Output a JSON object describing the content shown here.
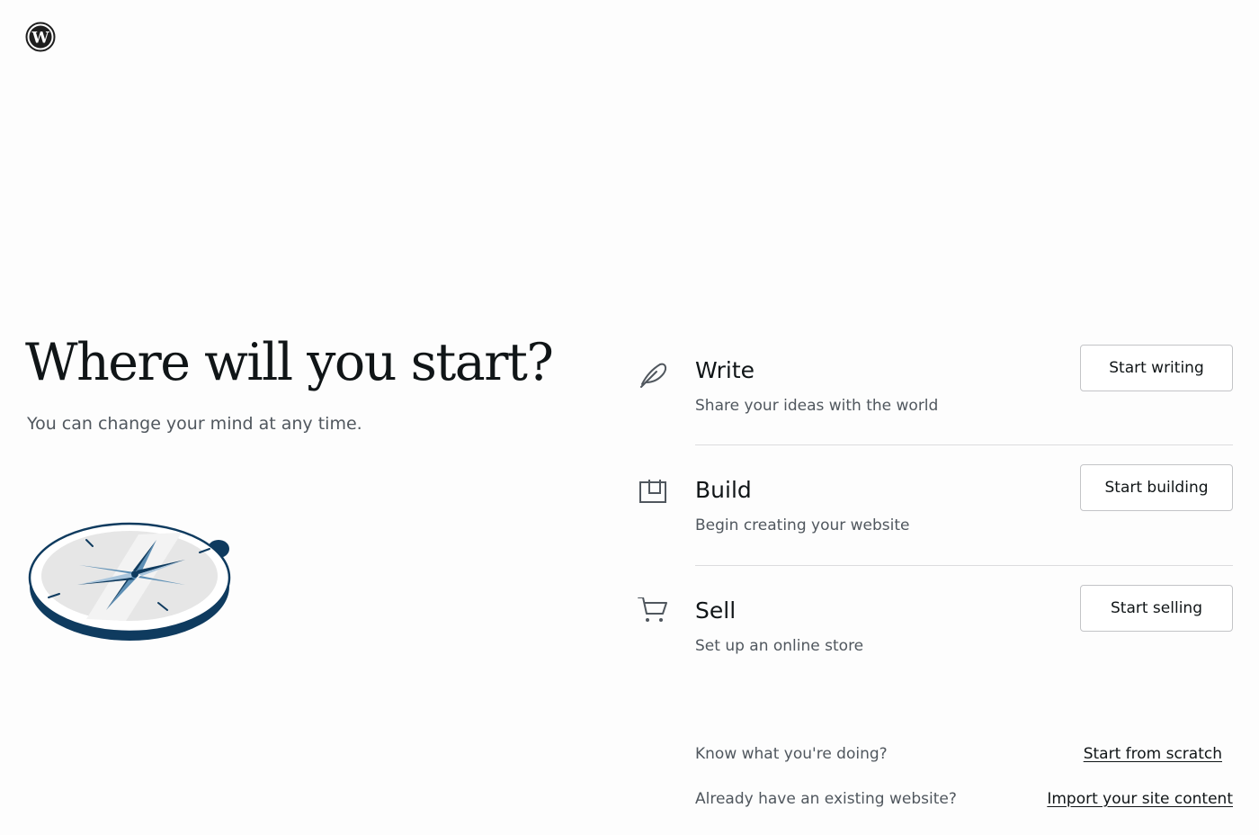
{
  "brand": {
    "logo_icon": "wordpress-logo-icon"
  },
  "hero": {
    "title": "Where will you start?",
    "subtitle": "You can change your mind at any time.",
    "illustration": "compass-illustration"
  },
  "options": [
    {
      "icon": "feather-icon",
      "title": "Write",
      "description": "Share your ideas with the world",
      "button_label": "Start writing"
    },
    {
      "icon": "layout-icon",
      "title": "Build",
      "description": "Begin creating your website",
      "button_label": "Start building"
    },
    {
      "icon": "cart-icon",
      "title": "Sell",
      "description": "Set up an online store",
      "button_label": "Start selling"
    }
  ],
  "footer": {
    "scratch": {
      "text": "Know what you're doing?",
      "link_label": "Start from scratch"
    },
    "import": {
      "text": "Already have an existing website?",
      "link_label": "Import your site content"
    }
  },
  "colors": {
    "text_primary": "#101517",
    "text_secondary": "#50575e",
    "compass_navy": "#0f3b5f",
    "border": "#c3c4c7"
  }
}
